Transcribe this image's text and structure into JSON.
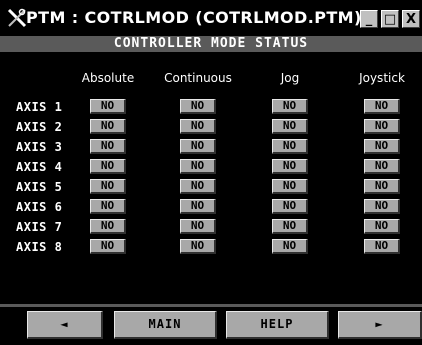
{
  "window": {
    "title": "PTM : COTRLMOD (COTRLMOD.PTM)",
    "controls": {
      "minimize": "_",
      "restore": "□",
      "close": "X"
    }
  },
  "screen": {
    "subtitle": "CONTROLLER MODE STATUS",
    "columns": [
      "Absolute",
      "Continuous",
      "Jog",
      "Joystick"
    ],
    "rows": [
      {
        "axis": "AXIS 1",
        "values": [
          "NO",
          "NO",
          "NO",
          "NO"
        ]
      },
      {
        "axis": "AXIS 2",
        "values": [
          "NO",
          "NO",
          "NO",
          "NO"
        ]
      },
      {
        "axis": "AXIS 3",
        "values": [
          "NO",
          "NO",
          "NO",
          "NO"
        ]
      },
      {
        "axis": "AXIS 4",
        "values": [
          "NO",
          "NO",
          "NO",
          "NO"
        ]
      },
      {
        "axis": "AXIS 5",
        "values": [
          "NO",
          "NO",
          "NO",
          "NO"
        ]
      },
      {
        "axis": "AXIS 6",
        "values": [
          "NO",
          "NO",
          "NO",
          "NO"
        ]
      },
      {
        "axis": "AXIS 7",
        "values": [
          "NO",
          "NO",
          "NO",
          "NO"
        ]
      },
      {
        "axis": "AXIS 8",
        "values": [
          "NO",
          "NO",
          "NO",
          "NO"
        ]
      }
    ]
  },
  "footer": {
    "prev": "◄",
    "main": "MAIN",
    "help": "HELP",
    "next": "►"
  },
  "colors": {
    "background": "#000000",
    "subtitle_bar": "#5a5a5a",
    "button_face": "#a8a8a8"
  },
  "icons": {
    "app": "ptm-app-icon"
  }
}
